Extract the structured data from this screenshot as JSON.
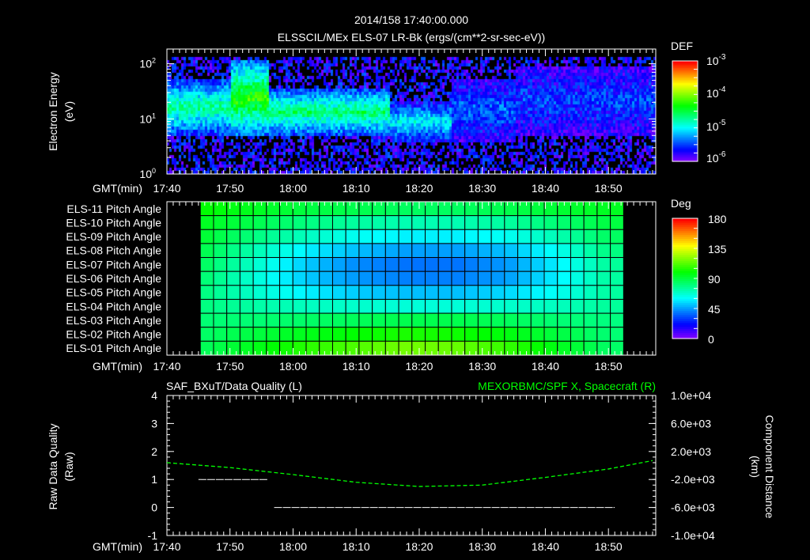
{
  "header": {
    "time": "2014/158 17:40:00.000",
    "subtitle": "ELSSCIL/MEx ELS-07 LR-Bk   (ergs/(cm**2-sr-sec-eV))"
  },
  "time_axis": {
    "label": "GMT(min)",
    "ticks": [
      "17:40",
      "17:50",
      "18:00",
      "18:10",
      "18:20",
      "18:30",
      "18:40",
      "18:50"
    ],
    "range_min": [
      0,
      77.5
    ]
  },
  "chart_data": [
    {
      "type": "heatmap",
      "ylabel": "Electron Energy",
      "yunit": "(eV)",
      "yscale": "log",
      "ylim": [
        1,
        185
      ],
      "yticks": [
        {
          "base": "10",
          "exp": "0"
        },
        {
          "base": "10",
          "exp": "1"
        },
        {
          "base": "10",
          "exp": "2"
        }
      ],
      "colorbar": {
        "title": "DEF",
        "scale": "log",
        "range": [
          -6,
          -3
        ],
        "ticks": [
          {
            "base": "10",
            "exp": "-3"
          },
          {
            "base": "10",
            "exp": "-4"
          },
          {
            "base": "10",
            "exp": "-5"
          },
          {
            "base": "10",
            "exp": "-6"
          }
        ]
      },
      "bands": [
        {
          "t0": "17:40",
          "t1": "17:50",
          "e_low": 5,
          "e_high": 60,
          "peak_log_def": -4.7
        },
        {
          "t0": "17:50",
          "t1": "17:56",
          "e_low": 5,
          "e_high": 130,
          "peak_log_def": -4.2
        },
        {
          "t0": "17:56",
          "t1": "18:15",
          "e_low": 5,
          "e_high": 40,
          "peak_log_def": -4.6
        },
        {
          "t0": "18:15",
          "t1": "18:25",
          "e_low": 4,
          "e_high": 22,
          "peak_log_def": -5.0
        },
        {
          "t0": "18:25",
          "t1": "18:35",
          "e_low": 4,
          "e_high": 60,
          "peak_log_def": -5.4
        },
        {
          "t0": "18:35",
          "t1": "18:57",
          "e_low": 5,
          "e_high": 100,
          "peak_log_def": -5.5
        }
      ],
      "background_log_def": -6
    },
    {
      "type": "heatmap",
      "rows": [
        "ELS-11 Pitch Angle",
        "ELS-10 Pitch Angle",
        "ELS-09 Pitch Angle",
        "ELS-08 Pitch Angle",
        "ELS-07 Pitch Angle",
        "ELS-06 Pitch Angle",
        "ELS-05 Pitch Angle",
        "ELS-04 Pitch Angle",
        "ELS-03 Pitch Angle",
        "ELS-02 Pitch Angle",
        "ELS-01 Pitch Angle"
      ],
      "data_span": [
        "17:45",
        "18:52"
      ],
      "sample_times": [
        "17:46",
        "17:54",
        "18:02",
        "18:10",
        "18:18",
        "18:26",
        "18:34",
        "18:42",
        "18:50"
      ],
      "values_deg": [
        [
          100,
          95,
          90,
          88,
          85,
          85,
          88,
          92,
          95
        ],
        [
          95,
          88,
          80,
          75,
          72,
          72,
          75,
          82,
          90
        ],
        [
          92,
          80,
          70,
          62,
          58,
          58,
          62,
          72,
          85
        ],
        [
          88,
          72,
          58,
          50,
          45,
          45,
          50,
          62,
          80
        ],
        [
          85,
          68,
          52,
          42,
          38,
          38,
          44,
          58,
          76
        ],
        [
          82,
          66,
          52,
          44,
          40,
          40,
          45,
          58,
          75
        ],
        [
          80,
          68,
          58,
          52,
          50,
          50,
          54,
          62,
          75
        ],
        [
          80,
          74,
          70,
          68,
          66,
          66,
          68,
          70,
          76
        ],
        [
          82,
          82,
          84,
          86,
          88,
          88,
          86,
          82,
          80
        ],
        [
          84,
          90,
          96,
          100,
          104,
          102,
          98,
          90,
          82
        ],
        [
          86,
          96,
          106,
          112,
          118,
          116,
          108,
          96,
          84
        ]
      ],
      "colorbar": {
        "title": "Deg",
        "range": [
          0,
          180
        ],
        "ticks": [
          "180",
          "135",
          "90",
          "45",
          "0"
        ]
      }
    },
    {
      "type": "line",
      "left_title": "SAF_BXuT/Data Quality (L)",
      "right_title": "MEXORBMC/SPF X, Spacecraft (R)",
      "ylabel_left": "Raw Data Quality",
      "yunit_left": "(Raw)",
      "ylabel_right": "Component Distance",
      "yunit_right": "(km)",
      "ylim_left": [
        -1,
        4
      ],
      "yticks_left": [
        "4",
        "3",
        "2",
        "1",
        "0",
        "-1"
      ],
      "ylim_right": [
        -10000,
        10000
      ],
      "yticks_right": [
        "1.0e+04",
        "6.0e+03",
        "2.0e+03",
        "-2.0e+03",
        "-6.0e+03",
        "-1.0e+04"
      ],
      "colors": {
        "quality": "#ffffff",
        "position": "#00ff00"
      },
      "quality_segments": [
        {
          "t0": "17:45",
          "t1": "17:56",
          "value": 1
        },
        {
          "t0": "17:57",
          "t1": "18:51",
          "value": 0
        }
      ],
      "position_x": [
        "17:40",
        "17:50",
        "18:00",
        "18:10",
        "18:20",
        "18:30",
        "18:40",
        "18:50",
        "18:57"
      ],
      "position_y": [
        400,
        -300,
        -1300,
        -2400,
        -3000,
        -2800,
        -1700,
        -500,
        700
      ]
    }
  ]
}
